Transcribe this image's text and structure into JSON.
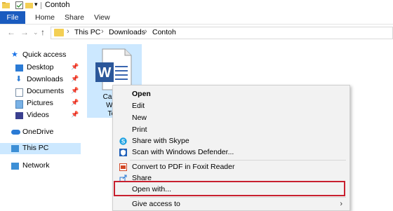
{
  "window": {
    "title": "Contoh"
  },
  "ribbon": {
    "tabs": [
      "File",
      "Home",
      "Share",
      "View"
    ]
  },
  "address": {
    "crumbs": [
      "This PC",
      "Downloads",
      "Contoh"
    ]
  },
  "sidebar": {
    "items": [
      {
        "label": "Quick access"
      },
      {
        "label": "Desktop"
      },
      {
        "label": "Downloads"
      },
      {
        "label": "Documents"
      },
      {
        "label": "Pictures"
      },
      {
        "label": "Videos"
      },
      {
        "label": "OneDrive"
      },
      {
        "label": "This PC"
      },
      {
        "label": "Network"
      }
    ]
  },
  "file": {
    "line1": "Cara M",
    "line2": "Word",
    "line3": "Terk"
  },
  "context_menu": {
    "items": [
      {
        "label": "Open"
      },
      {
        "label": "Edit"
      },
      {
        "label": "New"
      },
      {
        "label": "Print"
      },
      {
        "label": "Share with Skype"
      },
      {
        "label": "Scan with Windows Defender..."
      },
      {
        "label": "Convert to PDF in Foxit Reader"
      },
      {
        "label": "Share"
      },
      {
        "label": "Open with..."
      },
      {
        "label": "Give access to"
      }
    ]
  },
  "colors": {
    "accent": "#1a5bbf",
    "selection": "#cce8ff",
    "highlight": "#c8202f"
  }
}
